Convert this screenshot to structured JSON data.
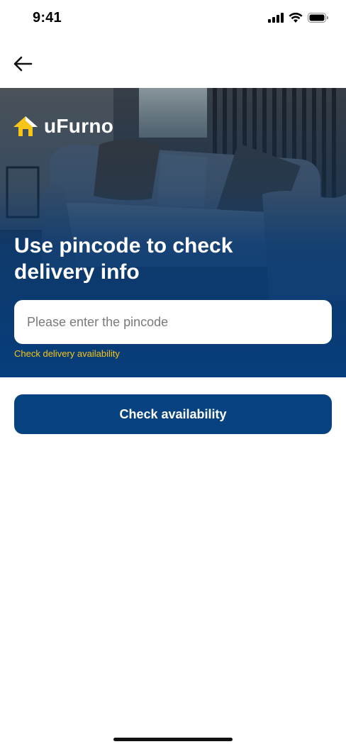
{
  "status_bar": {
    "time": "9:41",
    "icons": [
      "signal-icon",
      "wifi-icon",
      "battery-icon"
    ]
  },
  "nav": {
    "back_icon": "arrow-left-icon"
  },
  "hero": {
    "brand_name": "uFurno",
    "logo_icon": "house-logo-icon",
    "title": "Use pincode to check delivery info",
    "pincode_placeholder": "Please enter the pincode",
    "pincode_value": "",
    "helper_text": "Check delivery availability"
  },
  "actions": {
    "check_label": "Check availability"
  },
  "colors": {
    "primary": "#06427f",
    "accent_yellow": "#f5c518",
    "hero_overlay": "#0b3a70"
  }
}
